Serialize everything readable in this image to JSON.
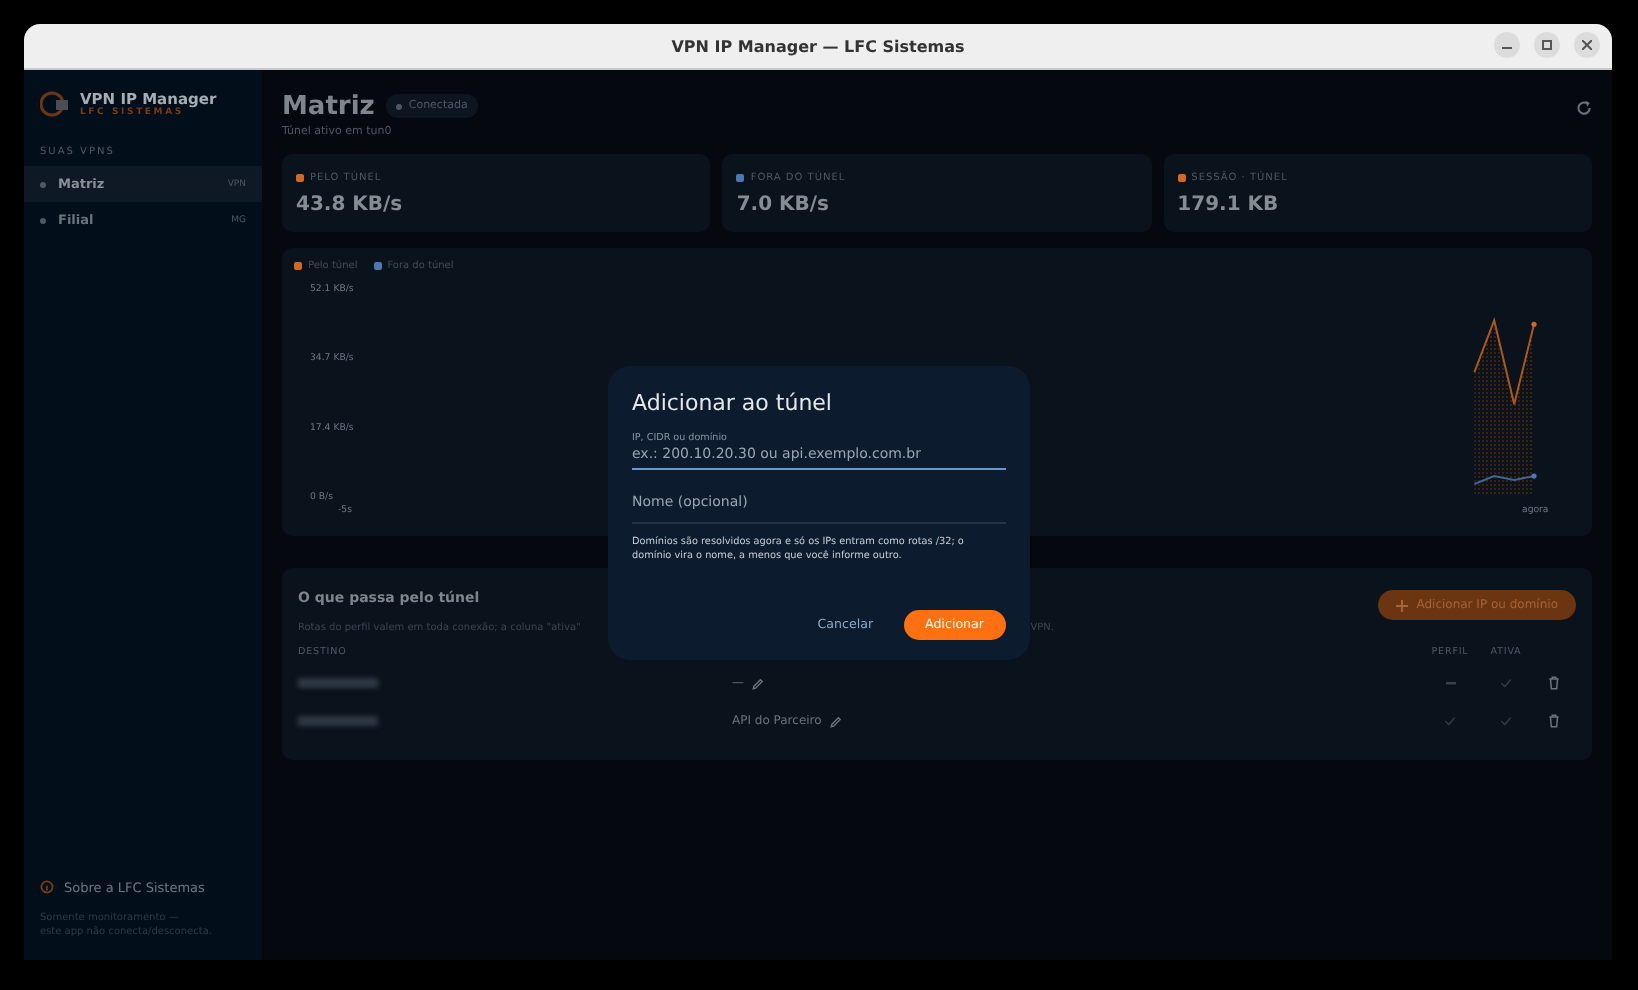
{
  "window": {
    "title": "VPN IP Manager — LFC Sistemas"
  },
  "sidebar": {
    "app_name": "VPN IP Manager",
    "brand": "LFC SISTEMAS",
    "section": "SUAS VPNS",
    "items": [
      {
        "label": "Matriz",
        "badge": "VPN",
        "selected": true
      },
      {
        "label": "Filial",
        "badge": "MG",
        "selected": false
      }
    ],
    "about": "Sobre a LFC Sistemas",
    "footer": "Somente monitoramento —\neste app não conecta/desconecta."
  },
  "header": {
    "title": "Matriz",
    "status": "Conectada",
    "subtitle": "Túnel ativo em tun0"
  },
  "stats": [
    {
      "label": "PELO TÚNEL",
      "value": "43.8 KB/s",
      "color": "#d2691e"
    },
    {
      "label": "FORA DO TÚNEL",
      "value": "7.0 KB/s",
      "color": "#4a78b0"
    },
    {
      "label": "SESSÃO · TÚNEL",
      "value": "179.1 KB",
      "color": "#d2691e"
    }
  ],
  "chart": {
    "chart_data": {
      "type": "line",
      "categories": [
        "-5s",
        null,
        null,
        null,
        null,
        null,
        null,
        null,
        null,
        null,
        null,
        null,
        null,
        null,
        null,
        null,
        null,
        null,
        null,
        null,
        null,
        null,
        null,
        null,
        null,
        null,
        null,
        null,
        null,
        null,
        null,
        null,
        null,
        null,
        null,
        null,
        null,
        null,
        null,
        null,
        null,
        null,
        null,
        null,
        null,
        null,
        null,
        null,
        null,
        null,
        null,
        null,
        null,
        null,
        null,
        null,
        null,
        null,
        null,
        "agora"
      ],
      "ylim": [
        0,
        52.1
      ],
      "yticks": [
        {
          "value": 0,
          "label": "0 B/s"
        },
        {
          "value": 17.4,
          "label": "17.4 KB/s"
        },
        {
          "value": 34.7,
          "label": "34.7 KB/s"
        },
        {
          "value": 52.1,
          "label": "52.1 KB/s"
        }
      ],
      "series": [
        {
          "name": "Pelo túnel",
          "color": "#d2691e",
          "values": [
            null,
            null,
            null,
            null,
            null,
            null,
            null,
            null,
            null,
            null,
            null,
            null,
            null,
            null,
            null,
            null,
            null,
            null,
            null,
            null,
            null,
            null,
            null,
            null,
            null,
            null,
            null,
            null,
            null,
            null,
            null,
            null,
            null,
            null,
            null,
            null,
            null,
            null,
            null,
            null,
            null,
            null,
            null,
            null,
            null,
            null,
            null,
            null,
            null,
            null,
            null,
            null,
            null,
            null,
            null,
            null,
            31,
            44,
            23,
            43
          ]
        },
        {
          "name": "Fora do túnel",
          "color": "#4a78b0",
          "values": [
            null,
            null,
            null,
            null,
            null,
            null,
            null,
            null,
            null,
            null,
            null,
            null,
            null,
            null,
            null,
            null,
            null,
            null,
            null,
            null,
            null,
            null,
            null,
            null,
            null,
            null,
            null,
            null,
            null,
            null,
            null,
            null,
            null,
            null,
            null,
            null,
            null,
            null,
            null,
            null,
            null,
            null,
            null,
            null,
            null,
            null,
            null,
            null,
            null,
            null,
            null,
            null,
            null,
            null,
            null,
            null,
            3,
            5,
            4,
            5
          ]
        }
      ]
    }
  },
  "routes": {
    "title": "O que passa pelo túnel",
    "subtitle": "Rotas do perfil valem em toda conexão; a coluna \"ativa\"",
    "subtitle_end": "VPN.",
    "add_button": "Adicionar IP ou domínio",
    "columns": [
      "DESTINO",
      "PERFIL",
      "ATIVA"
    ],
    "rows": [
      {
        "destination_blurred": true,
        "name": "—",
        "profile": false,
        "active": true
      },
      {
        "destination_blurred": true,
        "name": "API do Parceiro",
        "profile": true,
        "active": true
      }
    ]
  },
  "dialog": {
    "title": "Adicionar ao túnel",
    "field_label": "IP, CIDR ou domínio",
    "field_placeholder": "ex.: 200.10.20.30 ou api.exemplo.com.br",
    "name_placeholder": "Nome (opcional)",
    "note": "Domínios são resolvidos agora e só os IPs entram como rotas /32; o domínio vira o nome, a menos que você informe outro.",
    "cancel": "Cancelar",
    "confirm": "Adicionar"
  }
}
